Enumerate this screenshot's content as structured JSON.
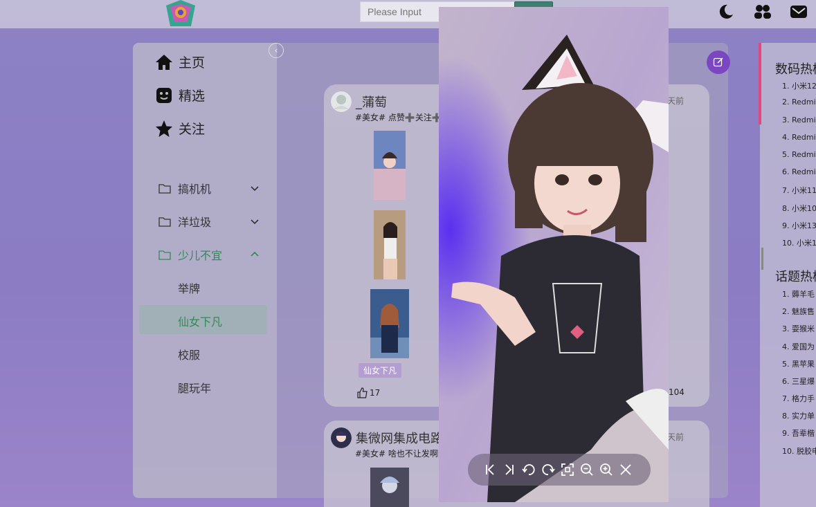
{
  "header": {
    "search_placeholder": "Please Input",
    "icons": [
      "moon-icon",
      "users-icon",
      "mail-icon"
    ]
  },
  "sidebar": {
    "main": [
      {
        "label": "主页",
        "icon": "home-icon"
      },
      {
        "label": "精选",
        "icon": "sticker-icon"
      },
      {
        "label": "关注",
        "icon": "star-icon"
      }
    ],
    "groups": [
      {
        "label": "搞机机",
        "expanded": false
      },
      {
        "label": "洋垃圾",
        "expanded": false
      },
      {
        "label": "少儿不宜",
        "expanded": true
      }
    ],
    "sub_items": [
      "举牌",
      "仙女下凡",
      "校服",
      "腿玩年"
    ],
    "active_sub": "仙女下凡"
  },
  "feed": {
    "posts": [
      {
        "author": "_蒲萄",
        "tagline": "#美女# 点赞➕关注➕",
        "time": "天前",
        "badge": "仙女下凡",
        "likes": "17",
        "comments": "104"
      },
      {
        "author": "集微网集成电路",
        "tagline": "#美女# 啥也不让发啊[美",
        "time": "天前"
      }
    ]
  },
  "right_panel": {
    "digital_title": "数码热榜",
    "digital_items": [
      "1. 小米12",
      "2. Redmi",
      "3. Redmi",
      "4. Redmi",
      "5. Redmi",
      "6. Redmi",
      "7. 小米11",
      "8. 小米10",
      "9. 小米13",
      "10. 小米1"
    ],
    "topic_title": "话题热榜",
    "topic_items": [
      "1. 薅羊毛",
      "2. 魅族售",
      "3. 耍猴米",
      "4. 爱国为",
      "5. 黑苹果",
      "6. 三星爆",
      "7. 格力手",
      "8. 实力单",
      "9. 吾辈楷",
      "10. 脱胶申"
    ]
  },
  "viewer": {
    "toolbar": [
      "first-icon",
      "last-icon",
      "rotate-left-icon",
      "rotate-right-icon",
      "fit-screen-icon",
      "zoom-out-icon",
      "zoom-in-icon",
      "close-icon"
    ]
  }
}
